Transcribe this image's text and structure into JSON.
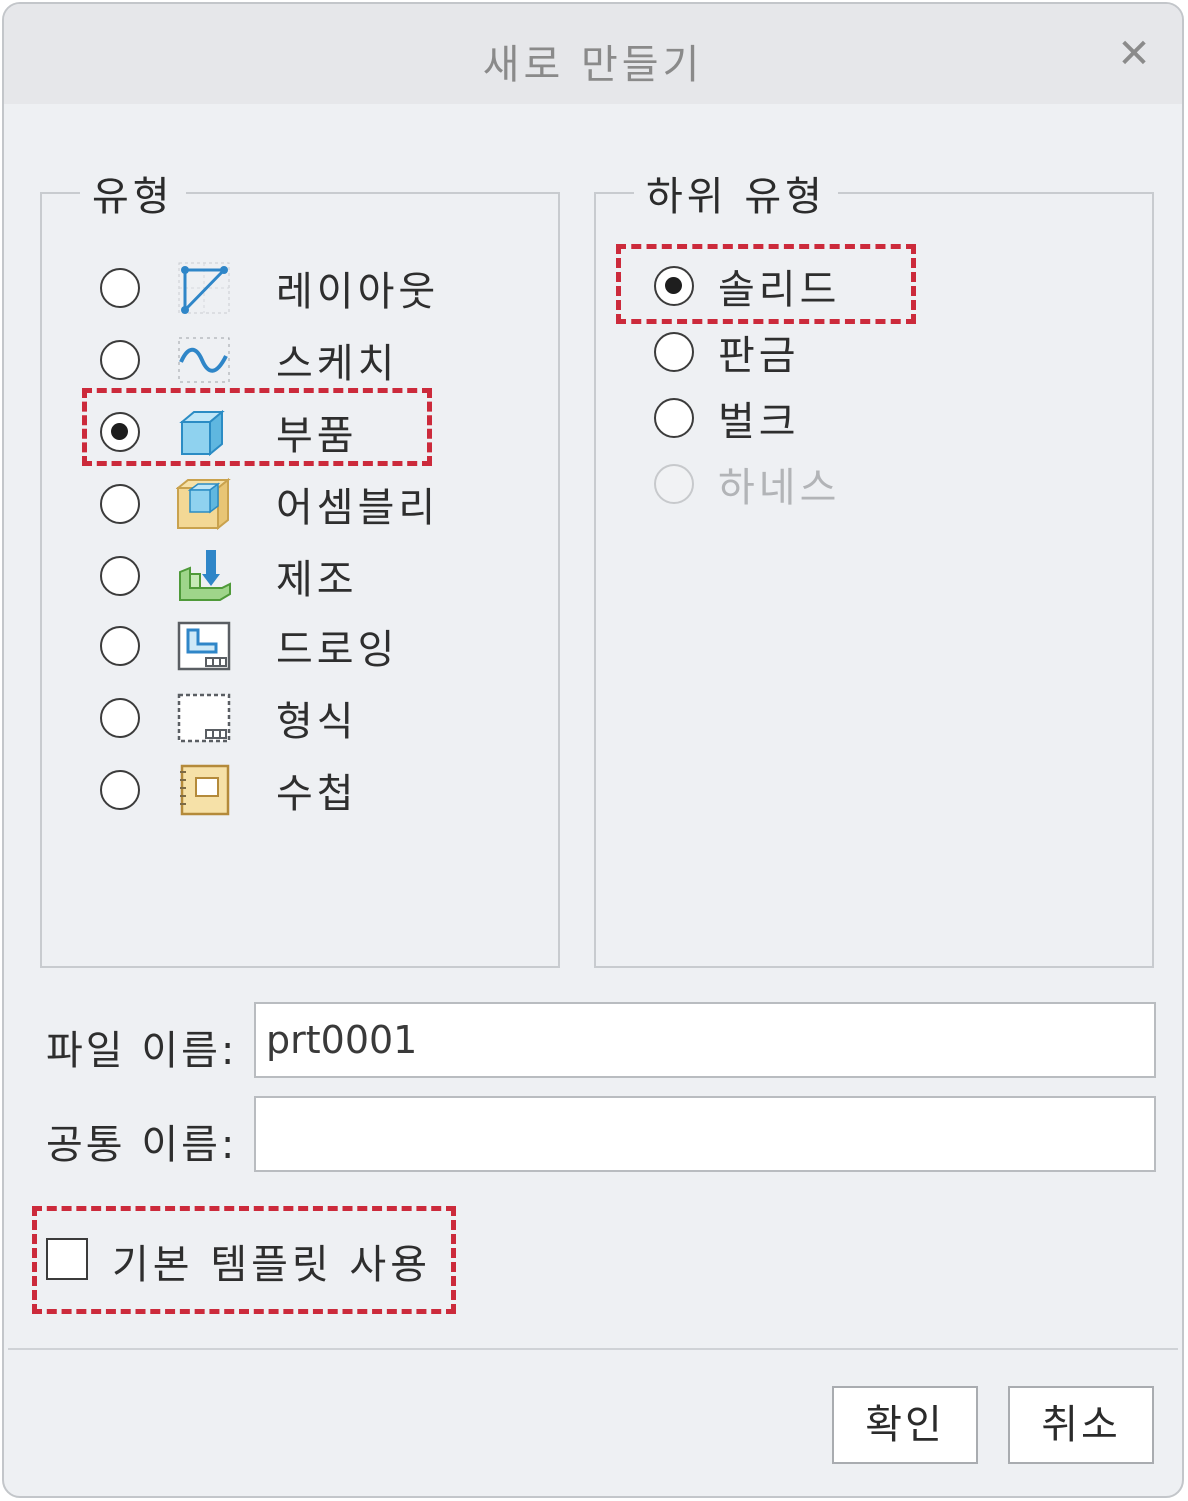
{
  "dialog": {
    "title": "새로 만들기",
    "close_icon": "close-icon"
  },
  "type_group": {
    "legend": "유형",
    "items": [
      {
        "label": "레이아웃",
        "icon": "layout-icon",
        "selected": false
      },
      {
        "label": "스케치",
        "icon": "sketch-icon",
        "selected": false
      },
      {
        "label": "부품",
        "icon": "part-icon",
        "selected": true
      },
      {
        "label": "어셈블리",
        "icon": "assembly-icon",
        "selected": false
      },
      {
        "label": "제조",
        "icon": "manufacturing-icon",
        "selected": false
      },
      {
        "label": "드로잉",
        "icon": "drawing-icon",
        "selected": false
      },
      {
        "label": "형식",
        "icon": "format-icon",
        "selected": false
      },
      {
        "label": "수첩",
        "icon": "notebook-icon",
        "selected": false
      }
    ]
  },
  "subtype_group": {
    "legend": "하위 유형",
    "items": [
      {
        "label": "솔리드",
        "selected": true,
        "disabled": false
      },
      {
        "label": "판금",
        "selected": false,
        "disabled": false
      },
      {
        "label": "벌크",
        "selected": false,
        "disabled": false
      },
      {
        "label": "하네스",
        "selected": false,
        "disabled": true
      }
    ]
  },
  "file_name": {
    "label": "파일 이름:",
    "value": "prt0001"
  },
  "common_name": {
    "label": "공통 이름:",
    "value": ""
  },
  "use_default_template": {
    "label": "기본 템플릿 사용",
    "checked": false
  },
  "buttons": {
    "ok": "확인",
    "cancel": "취소"
  },
  "colors": {
    "highlight": "#cc2a3b",
    "dialog_bg": "#eef0f3",
    "icon_blue": "#3a8fd0"
  }
}
